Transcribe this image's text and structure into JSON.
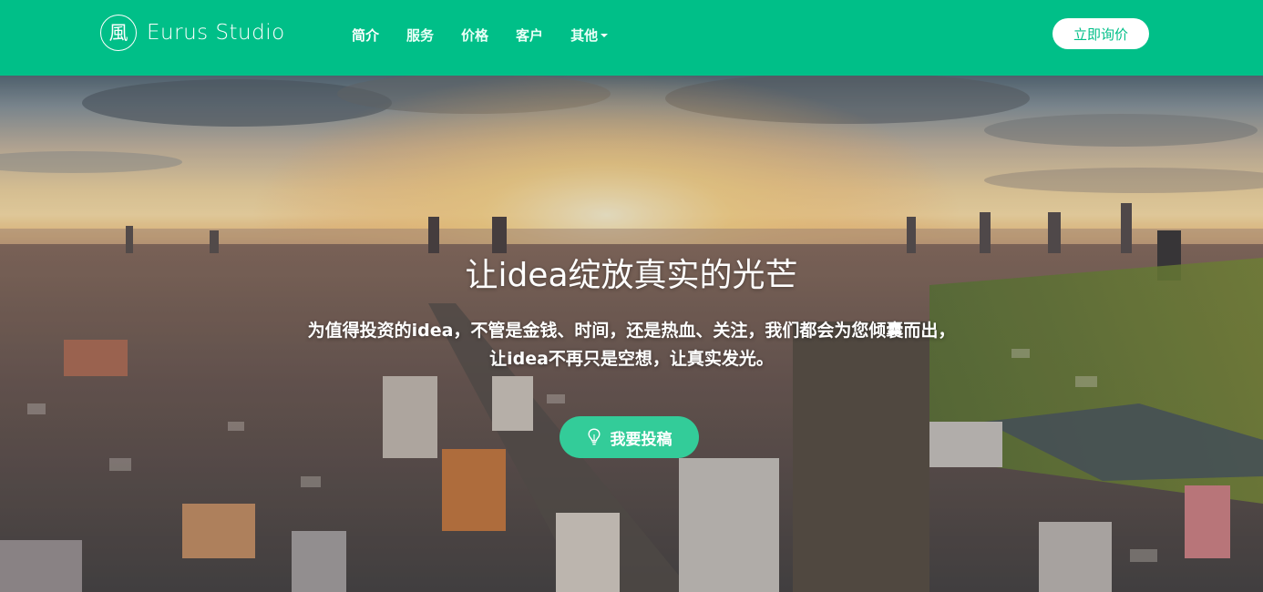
{
  "brand": {
    "logo_char": "風",
    "name": "Eurus Studio"
  },
  "nav": {
    "items": [
      {
        "label": "简介",
        "active": true
      },
      {
        "label": "服务",
        "active": false
      },
      {
        "label": "价格",
        "active": false
      },
      {
        "label": "客户",
        "active": false
      },
      {
        "label": "其他",
        "active": false,
        "dropdown": true
      }
    ],
    "cta_label": "立即询价"
  },
  "hero": {
    "title": "让idea绽放真实的光芒",
    "subtitle": "为值得投资的idea，不管是金钱、时间，还是热血、关注，我们都会为您倾囊而出，让idea不再只是空想，让真实发光。",
    "button_label": "我要投稿",
    "button_icon": "lightbulb-icon",
    "background": "city-skyline-sunset-photo"
  },
  "colors": {
    "brand_green": "#00bf88",
    "button_green": "#33cc99",
    "white": "#ffffff"
  }
}
